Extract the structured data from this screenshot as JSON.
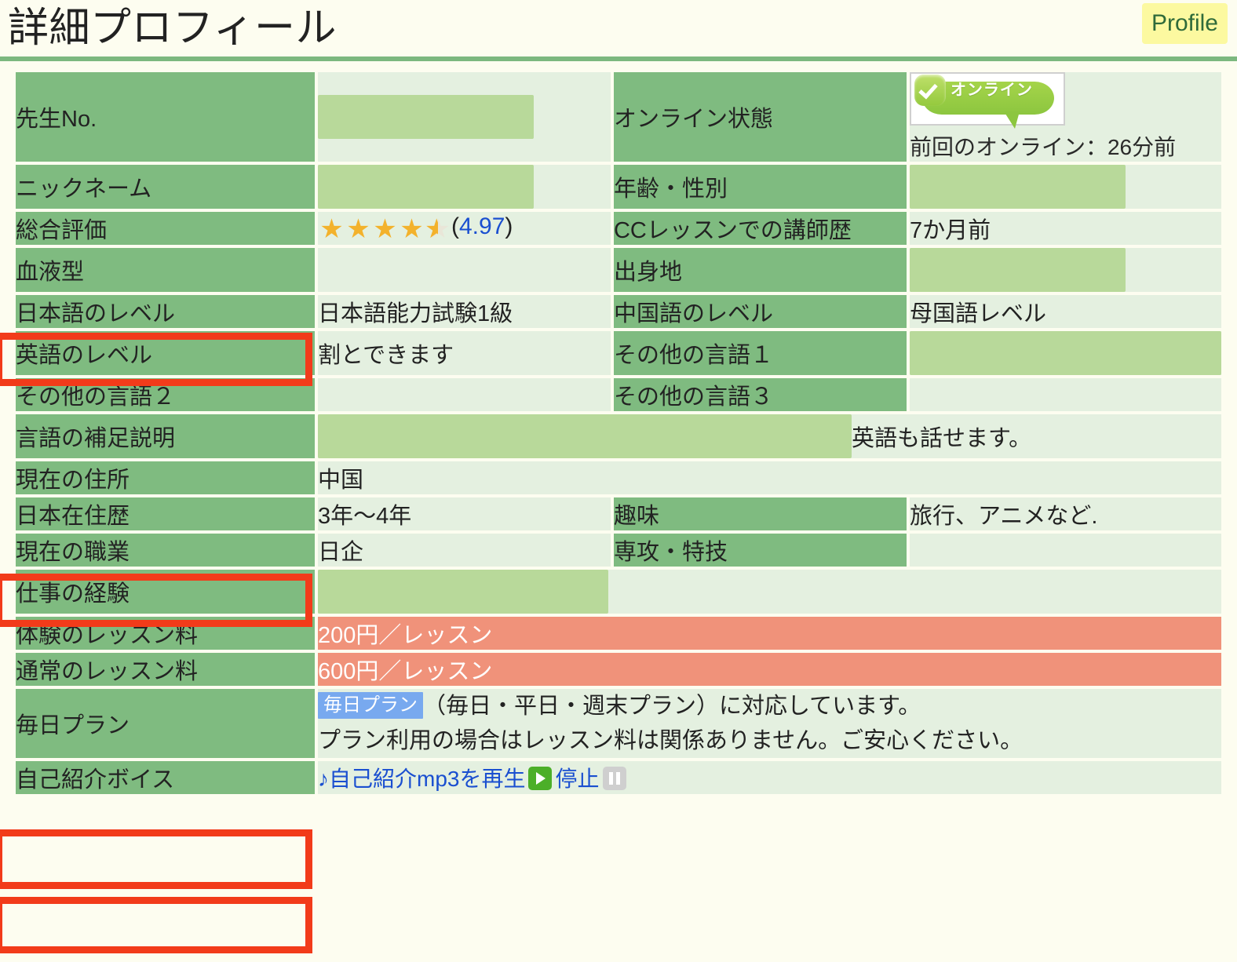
{
  "header": {
    "title": "詳細プロフィール",
    "badge": "Profile"
  },
  "online": {
    "bubble_text": "オンライン",
    "last_seen": "前回のオンライン：26分前"
  },
  "rating": {
    "score_text": "(4.97)",
    "score": "4.97",
    "open_paren": "(",
    "close_paren": ")",
    "stars_full": 4,
    "stars_half": 1
  },
  "labels": {
    "teacher_no": "先生No.",
    "online_status": "オンライン状態",
    "nickname": "ニックネーム",
    "age_gender": "年齢・性別",
    "overall_rating": "総合評価",
    "cc_teaching_history": "CCレッスンでの講師歴",
    "blood_type": "血液型",
    "birthplace": "出身地",
    "japanese_level": "日本語のレベル",
    "chinese_level": "中国語のレベル",
    "english_level": "英語のレベル",
    "other_language_1": "その他の言語１",
    "other_language_2": "その他の言語２",
    "other_language_3": "その他の言語３",
    "language_notes": "言語の補足説明",
    "current_address": "現在の住所",
    "japan_residence": "日本在住歴",
    "hobby": "趣味",
    "current_job": "現在の職業",
    "major_skill": "専攻・特技",
    "work_experience": "仕事の経験",
    "trial_lesson_fee": "体験のレッスン料",
    "regular_lesson_fee": "通常のレッスン料",
    "daily_plan": "毎日プラン",
    "intro_voice": "自己紹介ボイス"
  },
  "values": {
    "teacher_no": "",
    "nickname": "",
    "age_gender": "",
    "cc_teaching_history": "7か月前",
    "blood_type": "",
    "birthplace": "",
    "japanese_level": "日本語能力試験1級",
    "chinese_level": "母国語レベル",
    "english_level": "割とできます",
    "other_language_1": "",
    "other_language_2": "",
    "other_language_3": "",
    "language_notes": "英語も話せます。",
    "current_address": "中国",
    "japan_residence": "3年〜4年",
    "hobby": "旅行、アニメなど.",
    "current_job": "日企",
    "major_skill": "",
    "work_experience": "",
    "trial_lesson_fee": "200円／レッスン",
    "regular_lesson_fee": "600円／レッスン"
  },
  "plan": {
    "badge": "毎日プラン",
    "line1": "（毎日・平日・週末プラン）に対応しています。",
    "line2": "プラン利用の場合はレッスン料は関係ありません。ご安心ください。"
  },
  "voice": {
    "play_label": "♪自己紹介mp3を再生",
    "stop_label": "停止"
  },
  "colors": {
    "label_green": "#7fbb80",
    "value_green": "#e4f0e0",
    "mask_green": "#b8d99a",
    "price_salmon": "#f0927a",
    "highlight_red": "#f23b1a",
    "badge_yellow": "#fcf9a0",
    "plan_blue": "#78a9ef",
    "link_blue": "#1a4fd0",
    "star_gold": "#f3b22c",
    "page_bg": "#fdfdf0"
  }
}
